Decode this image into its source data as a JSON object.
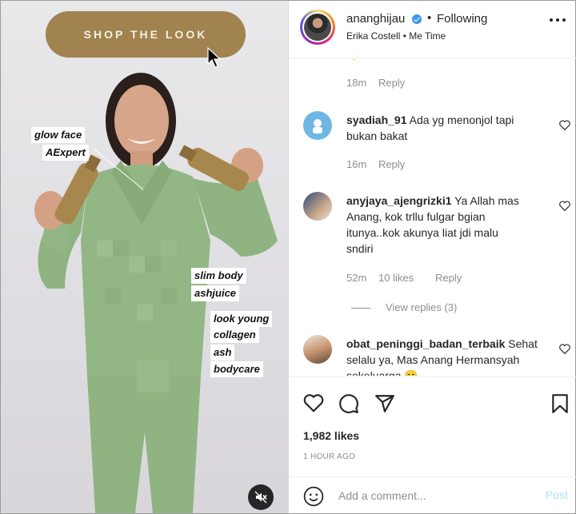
{
  "media": {
    "shop_button": "SHOP THE LOOK",
    "tags": [
      "glow face",
      "AExpert",
      "slim body",
      "ashjuice",
      "look young",
      "collagen",
      "ash",
      "bodycare"
    ]
  },
  "header": {
    "username": "ananghijau",
    "separator": "•",
    "following_label": "Following",
    "subtitle": "Erika Costell • Me Time"
  },
  "comments": [
    {
      "time": "18m",
      "reply_label": "Reply"
    },
    {
      "username": "syadiah_91",
      "text": "Ada yg menonjol tapi bukan bakat",
      "line1": "Ada yg menonjol tapi",
      "line2": "bukan bakat",
      "time": "16m",
      "reply_label": "Reply"
    },
    {
      "username": "anyjaya_ajengrizki1",
      "line1": "Ya Allah mas",
      "line2": "Anang, kok trllu fulgar bgian",
      "line3": "itunya..kok akunya liat jdi malu",
      "line4": "sndiri",
      "time": "52m",
      "likes": "10 likes",
      "reply_label": "Reply",
      "view_replies": "View replies (3)"
    },
    {
      "username": "obat_peninggi_badan_terbaik",
      "line1": "Sehat",
      "line2": "selalu ya, Mas Anang Hermansyah",
      "line3": "sekeluarga 😊"
    }
  ],
  "actions": {
    "likes": "1,982 likes",
    "time_ago": "1 HOUR AGO"
  },
  "add_comment": {
    "placeholder": "Add a comment...",
    "post_label": "Post"
  },
  "colors": {
    "shop_button": "#a0834f",
    "outfit": "#92b785",
    "link_disabled": "#b2dffc",
    "verified": "#3897f0"
  },
  "icons": [
    "cursor-arrow-icon",
    "mute-icon",
    "verified-icon",
    "more-options-icon",
    "heart-icon",
    "comment-icon",
    "share-icon",
    "bookmark-icon",
    "emoji-icon"
  ]
}
